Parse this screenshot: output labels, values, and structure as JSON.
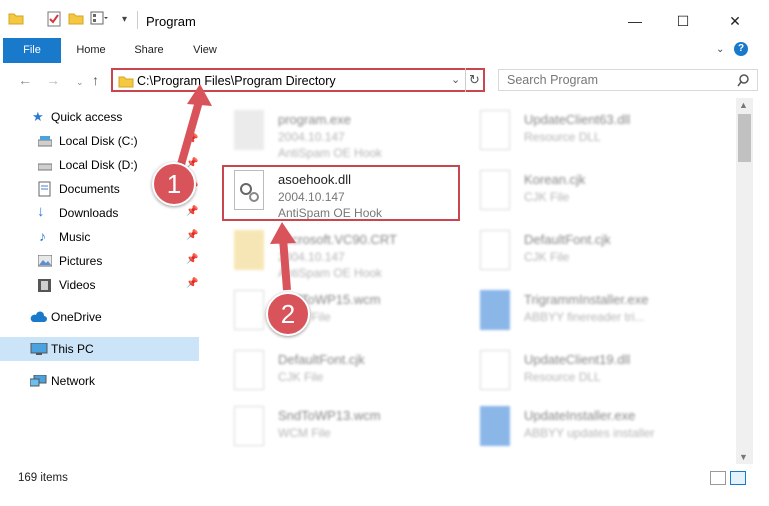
{
  "window": {
    "title": "Program"
  },
  "ribbon": {
    "tabs": [
      "File",
      "Home",
      "Share",
      "View"
    ]
  },
  "address": {
    "path": "C:\\Program Files\\Program Directory",
    "search_placeholder": "Search Program"
  },
  "nav": [
    {
      "label": "Quick access",
      "icon": "star-icon",
      "pinned": false
    },
    {
      "label": "Local Disk (C:)",
      "icon": "drive-icon",
      "pinned": true
    },
    {
      "label": "Local Disk (D:)",
      "icon": "drive-icon",
      "pinned": true
    },
    {
      "label": "Documents",
      "icon": "documents-icon",
      "pinned": true
    },
    {
      "label": "Downloads",
      "icon": "download-icon",
      "pinned": true
    },
    {
      "label": "Music",
      "icon": "music-icon",
      "pinned": true
    },
    {
      "label": "Pictures",
      "icon": "pictures-icon",
      "pinned": true
    },
    {
      "label": "Videos",
      "icon": "videos-icon",
      "pinned": true
    },
    {
      "label": "OneDrive",
      "icon": "cloud-icon",
      "pinned": false
    },
    {
      "label": "This PC",
      "icon": "pc-icon",
      "pinned": false,
      "selected": true
    },
    {
      "label": "Network",
      "icon": "network-icon",
      "pinned": false
    }
  ],
  "files_left": [
    {
      "name": "program.exe",
      "version": "2004.10.147",
      "desc": "AntiSpam OE Hook",
      "blur": true
    },
    {
      "name": "asoehook.dll",
      "version": "2004.10.147",
      "desc": "AntiSpam OE Hook",
      "blur": false
    },
    {
      "name": "Microsoft.VC90.CRT",
      "version": "2004.10.147",
      "desc": "AntiSpam OE Hook",
      "blur": true
    },
    {
      "name": "SndToWP15.wcm",
      "version": "WCM File",
      "desc": "",
      "blur": true
    },
    {
      "name": "DefaultFont.cjk",
      "version": "CJK File",
      "desc": "",
      "blur": true
    },
    {
      "name": "SndToWP13.wcm",
      "version": "WCM File",
      "desc": "",
      "blur": true
    }
  ],
  "files_right": [
    {
      "name": "UpdateClient63.dll",
      "version": "Resource DLL"
    },
    {
      "name": "Korean.cjk",
      "version": "CJK File"
    },
    {
      "name": "DefaultFont.cjk",
      "version": "CJK File"
    },
    {
      "name": "TrigrammInstaller.exe",
      "version": "ABBYY finereader tri..."
    },
    {
      "name": "UpdateClient19.dll",
      "version": "Resource DLL"
    },
    {
      "name": "UpdateInstaller.exe",
      "version": "ABBYY updates installer"
    }
  ],
  "status": {
    "items": "169 items"
  },
  "annotations": {
    "step1": "1",
    "step2": "2"
  },
  "colors": {
    "accent": "#1979ca",
    "highlight": "#c9464e",
    "badge": "#d9535a"
  }
}
